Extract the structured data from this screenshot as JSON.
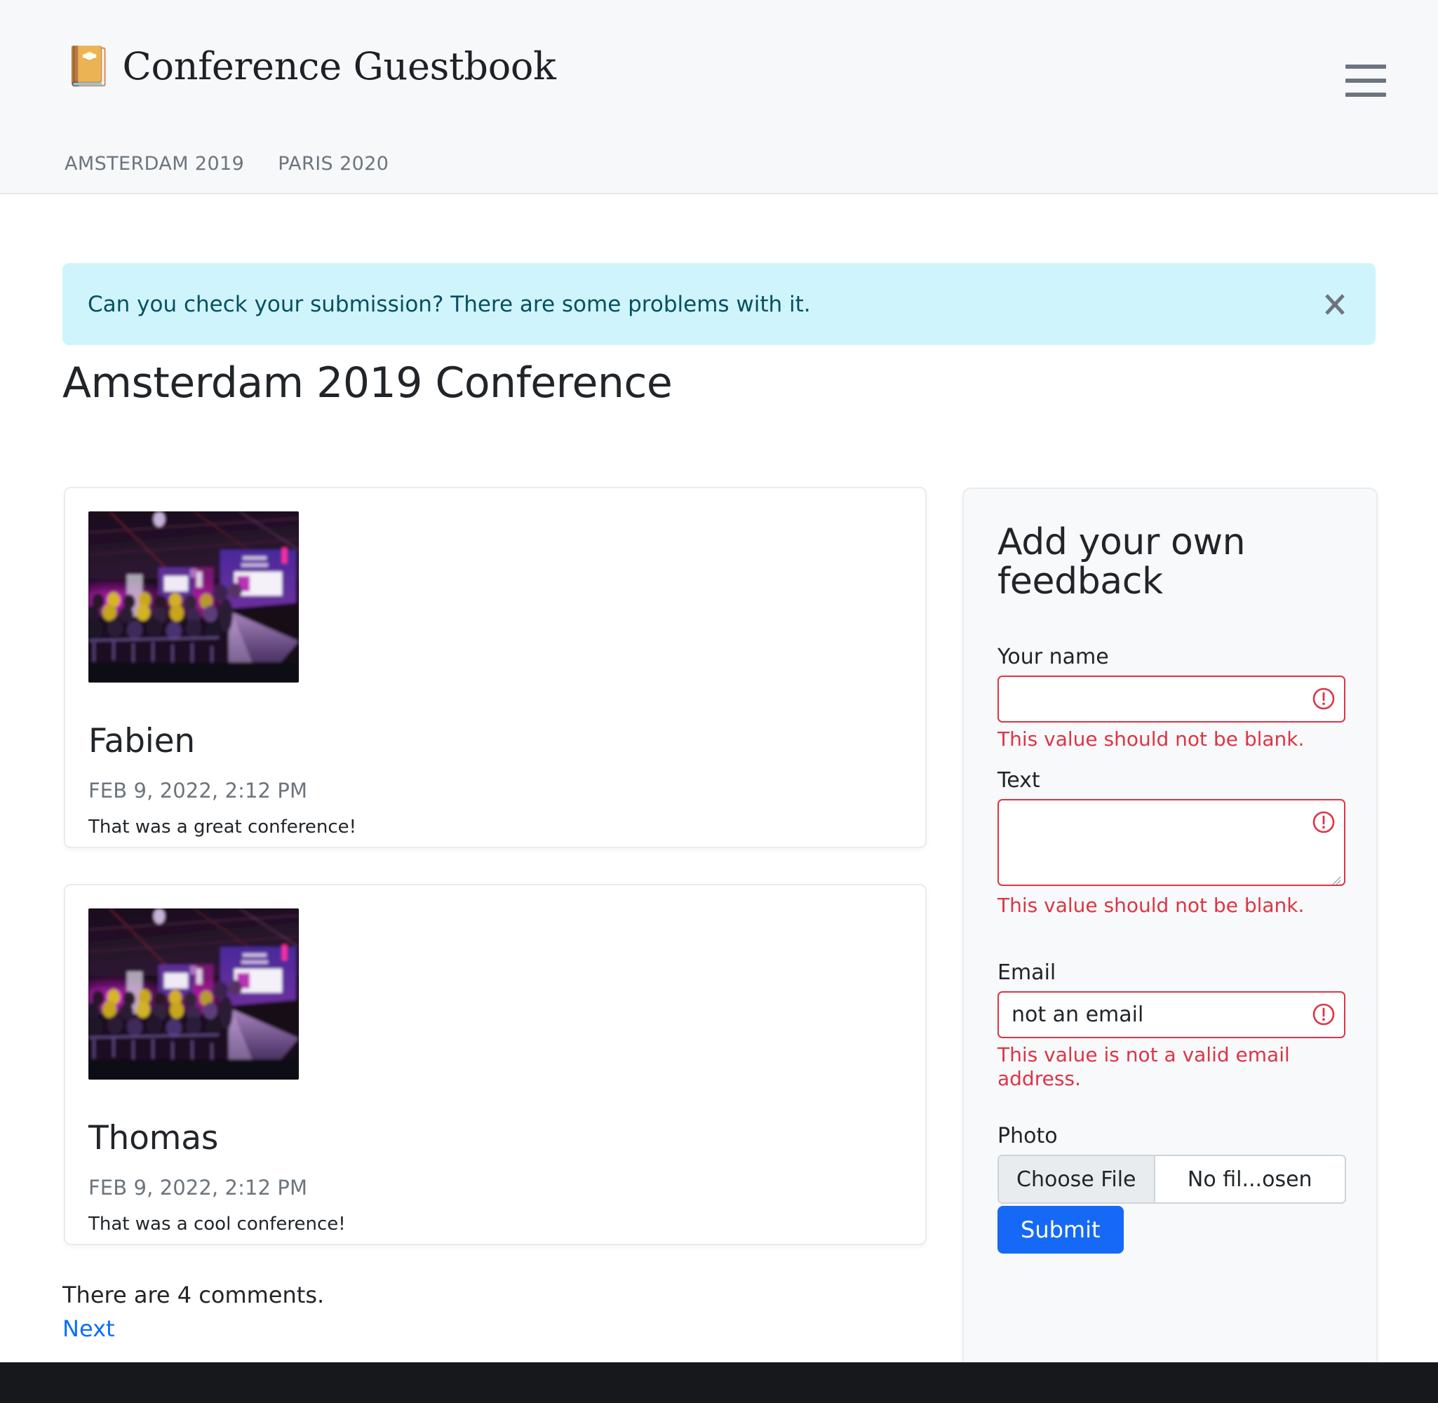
{
  "header": {
    "brand_icon": "notebook-icon",
    "brand_icon_glyph": "📔",
    "title": "Conference Guestbook",
    "menu_icon": "hamburger-menu-icon",
    "nav": [
      {
        "label": "AMSTERDAM 2019"
      },
      {
        "label": "PARIS 2020"
      }
    ]
  },
  "alert": {
    "message": "Can you check your submission? There are some problems with it.",
    "close_icon": "close-icon",
    "background_color": "#cff4fc",
    "text_color": "#055160"
  },
  "main": {
    "page_title": "Amsterdam 2019 Conference",
    "comments": [
      {
        "author": "Fabien",
        "date": "FEB 9, 2022, 2:12 PM",
        "text": "That was a great conference!",
        "photo_alt": "conference-hall-photo"
      },
      {
        "author": "Thomas",
        "date": "FEB 9, 2022, 2:12 PM",
        "text": "That was a cool conference!",
        "photo_alt": "conference-hall-photo"
      }
    ],
    "comments_count_text": "There are 4 comments.",
    "next_link": "Next"
  },
  "form": {
    "heading": "Add your own feedback",
    "name": {
      "label": "Your name",
      "value": "",
      "error": "This value should not be blank."
    },
    "text": {
      "label": "Text",
      "value": "",
      "error": "This value should not be blank."
    },
    "email": {
      "label": "Email",
      "value": "not an email",
      "error": "This value is not a valid email address."
    },
    "photo": {
      "label": "Photo",
      "button_label": "Choose File",
      "file_status": "No fil...osen"
    },
    "submit_label": "Submit",
    "accent_color": "#1569f6",
    "error_color": "#dc3545"
  }
}
